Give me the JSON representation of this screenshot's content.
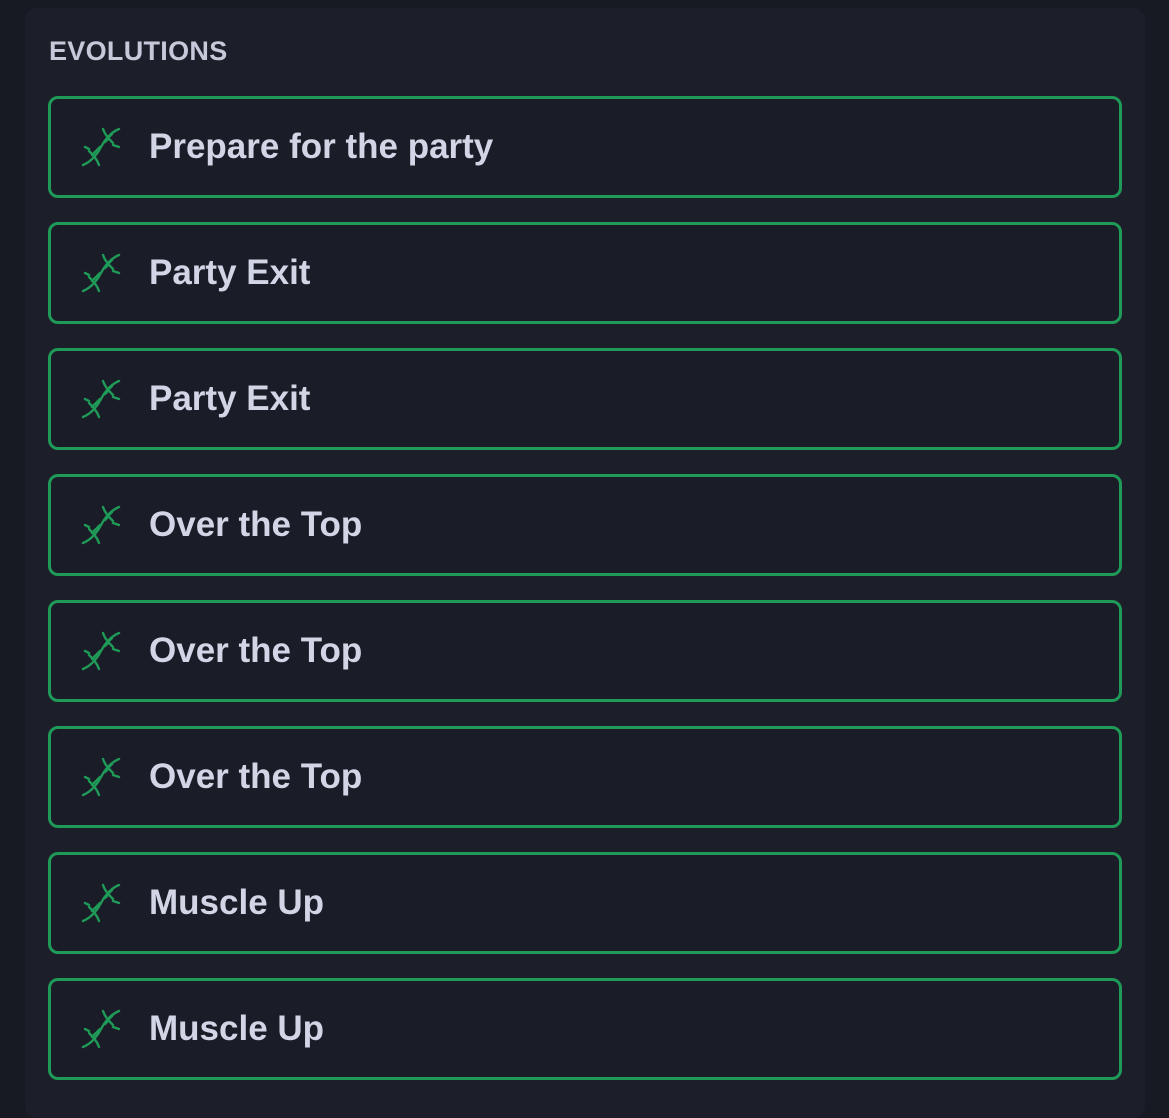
{
  "section": {
    "title": "EVOLUTIONS"
  },
  "colors": {
    "background": "#171a22",
    "panel": "#1c1f29",
    "accent_green": "#1f9a58",
    "text": "#d2d5e5"
  },
  "evolutions": [
    {
      "label": "Prepare for the party",
      "icon": "dna-icon"
    },
    {
      "label": "Party Exit",
      "icon": "dna-icon"
    },
    {
      "label": "Party Exit",
      "icon": "dna-icon"
    },
    {
      "label": "Over the Top",
      "icon": "dna-icon"
    },
    {
      "label": "Over the Top",
      "icon": "dna-icon"
    },
    {
      "label": "Over the Top",
      "icon": "dna-icon"
    },
    {
      "label": "Muscle Up",
      "icon": "dna-icon"
    },
    {
      "label": "Muscle Up",
      "icon": "dna-icon"
    }
  ]
}
